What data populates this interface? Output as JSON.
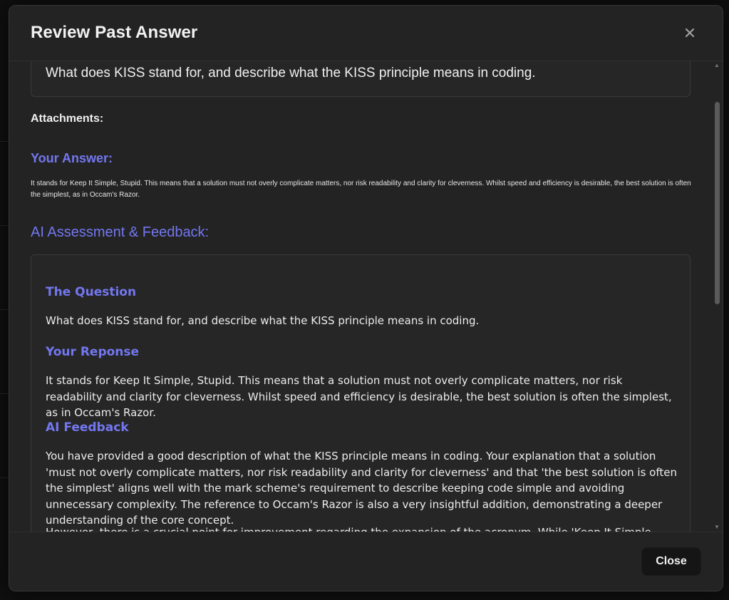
{
  "modal": {
    "title": "Review Past Answer",
    "close_icon": "close-icon",
    "question_text": "What does KISS stand for, and describe what the KISS principle means in coding.",
    "attachments_label": "Attachments:",
    "your_answer_heading": "Your Answer:",
    "your_answer_text": "It stands for Keep It Simple, Stupid. This means that a solution must not overly complicate matters, nor risk readability and clarity for cleverness. Whilst speed and efficiency is desirable, the best solution is often the simplest, as in Occam's Razor.",
    "ai_heading": "AI Assessment & Feedback:",
    "feedback": {
      "question_heading": "The Question",
      "question_text": "What does KISS stand for, and describe what the KISS principle means in coding.",
      "response_heading": "Your Reponse",
      "response_text": "It stands for Keep It Simple, Stupid. This means that a solution must not overly complicate matters, nor risk readability and clarity for cleverness. Whilst speed and efficiency is desirable, the best solution is often the simplest, as in Occam's Razor.",
      "ai_feedback_heading": "AI Feedback",
      "ai_feedback_p1": "You have provided a good description of what the KISS principle means in coding. Your explanation that a solution 'must not overly complicate matters, nor risk readability and clarity for cleverness' and that 'the best solution is often the simplest' aligns well with the mark scheme's requirement to describe keeping code simple and avoiding unnecessary complexity. The reference to Occam's Razor is also a very insightful addition, demonstrating a deeper understanding of the core concept.",
      "ai_feedback_p2": "However, there is a crucial point for improvement regarding the expansion of the acronym. While 'Keep It Simple, Stupid' was"
    },
    "footer": {
      "close_label": "Close"
    }
  },
  "colors": {
    "accent": "#7377f0",
    "modal_bg": "#232323",
    "page_bg": "#0f0f10"
  }
}
